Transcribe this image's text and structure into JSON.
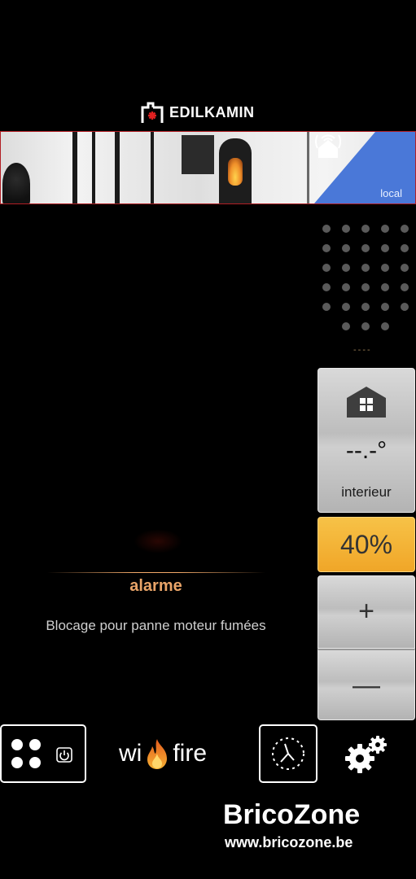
{
  "logo": {
    "text": "EDILKAMIN"
  },
  "banner": {
    "connection_label": "local",
    "connection_icon": "router-wifi-icon",
    "accent_color": "#4a78d8"
  },
  "status": {
    "dashes": "----"
  },
  "temperature": {
    "value": "--.-°",
    "label": "interieur",
    "icon": "house-icon"
  },
  "power": {
    "value": "40%",
    "color": "#f0a628"
  },
  "controls": {
    "plus": "+",
    "minus": "—"
  },
  "alarm": {
    "title": "alarme",
    "message": "Blocage pour panne moteur fumées",
    "color": "#e9a468"
  },
  "footer": {
    "wifire_left": "wi",
    "wifire_right": "fire"
  },
  "watermark": {
    "brand": "BricoZone",
    "url": "www.bricozone.be"
  }
}
